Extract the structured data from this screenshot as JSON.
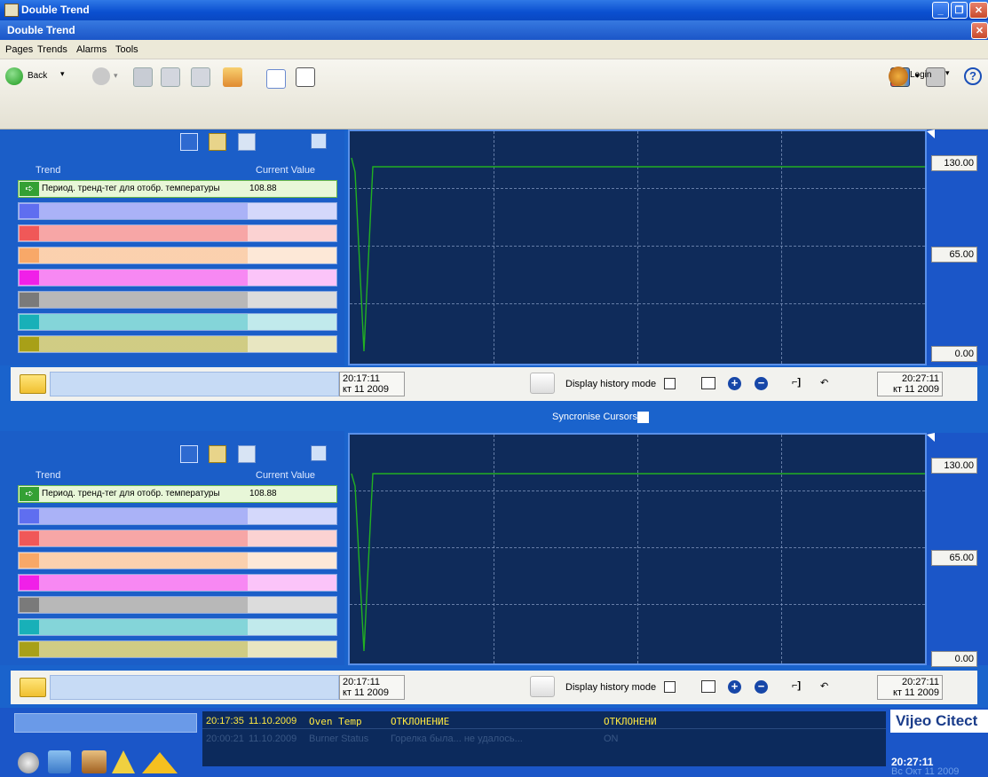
{
  "window": {
    "title": "Double Trend",
    "subtitle": "Double Trend"
  },
  "menu": [
    "Pages",
    "Trends",
    "Alarms",
    "Tools"
  ],
  "toolbar": {
    "back_label": "Back",
    "login_label": "Login"
  },
  "trend_panels": [
    {
      "legend_header": {
        "trend": "Trend",
        "current_value": "Current Value"
      },
      "trends": [
        {
          "name": "Период. тренд-тег для отобр. температуры",
          "value": "108.88",
          "color": "#2d8a2d"
        },
        {
          "name": "",
          "value": "",
          "color": "#5f6ef0"
        },
        {
          "name": "",
          "value": "",
          "color": "#f05858"
        },
        {
          "name": "",
          "value": "",
          "color": "#f8a868"
        },
        {
          "name": "",
          "value": "",
          "color": "#f020e8"
        },
        {
          "name": "",
          "value": "",
          "color": "#7a7a7a"
        },
        {
          "name": "",
          "value": "",
          "color": "#18b0b8"
        },
        {
          "name": "",
          "value": "",
          "color": "#a8a018"
        }
      ],
      "scale": {
        "max": "130.00",
        "mid": "65.00",
        "min": "0.00"
      },
      "start_time": "20:17:11",
      "start_date": "кт 11 2009",
      "end_time": "20:27:11",
      "end_date": "кт 11 2009",
      "history_label": "Display history mode"
    },
    {
      "legend_header": {
        "trend": "Trend",
        "current_value": "Current Value"
      },
      "trends": [
        {
          "name": "Период. тренд-тег для отобр. температуры",
          "value": "108.88",
          "color": "#2d8a2d"
        },
        {
          "name": "",
          "value": "",
          "color": "#5f6ef0"
        },
        {
          "name": "",
          "value": "",
          "color": "#f05858"
        },
        {
          "name": "",
          "value": "",
          "color": "#f8a868"
        },
        {
          "name": "",
          "value": "",
          "color": "#f020e8"
        },
        {
          "name": "",
          "value": "",
          "color": "#7a7a7a"
        },
        {
          "name": "",
          "value": "",
          "color": "#18b0b8"
        },
        {
          "name": "",
          "value": "",
          "color": "#a8a018"
        }
      ],
      "scale": {
        "max": "130.00",
        "mid": "65.00",
        "min": "0.00"
      },
      "start_time": "20:17:11",
      "start_date": "кт 11 2009",
      "end_time": "20:27:11",
      "end_date": "кт 11 2009",
      "history_label": "Display history mode"
    }
  ],
  "sync_label": "Syncronise Cursors",
  "alarms": [
    {
      "time": "20:17:35",
      "date": "11.10.2009",
      "tag": "Oven Temp",
      "desc": "ОТКЛОНЕНИЕ",
      "state": "ОТКЛОНЕНИ"
    },
    {
      "time": "20:00:21",
      "date": "11.10.2009",
      "tag": "Burner Status",
      "desc": "Горелка была... не удалось...",
      "state": "ON"
    }
  ],
  "brand": "Vijeo Citect",
  "clock": {
    "time": "20:27:11",
    "date": "Вс Окт 11 2009"
  },
  "colors": {
    "accent": "#1b56c8",
    "plot_bg": "#0f2b5a",
    "trend_line": "#22b022"
  }
}
